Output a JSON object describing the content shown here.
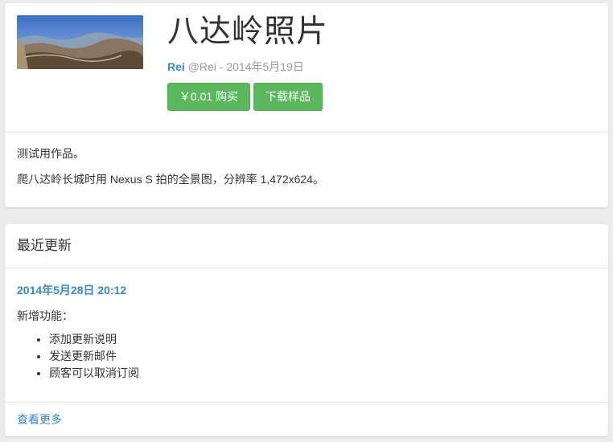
{
  "product": {
    "title": "八达岭照片",
    "author": "Rei",
    "handle_date": "@Rei - 2014年5月19日",
    "buy_label": "￥0.01 购买",
    "sample_label": "下载样品",
    "description": [
      "测试用作品。",
      "爬八达岭长城时用 Nexus S 拍的全景图，分辨率 1,472x624。"
    ]
  },
  "updates": {
    "heading": "最近更新",
    "date": "2014年5月28日 20:12",
    "intro": "新增功能：",
    "items": [
      "添加更新说明",
      "发送更新邮件",
      "顾客可以取消订阅"
    ],
    "view_more": "查看更多"
  },
  "colors": {
    "accent": "#3a87c8",
    "button": "#5cb85c"
  }
}
